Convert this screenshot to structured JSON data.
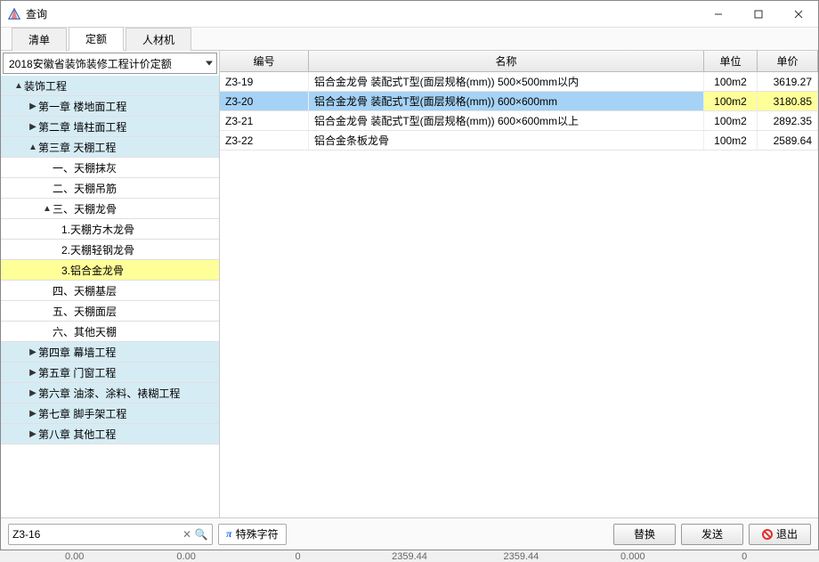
{
  "window": {
    "title": "查询"
  },
  "tabs": [
    {
      "label": "清单",
      "active": false
    },
    {
      "label": "定额",
      "active": true
    },
    {
      "label": "人材机",
      "active": false
    }
  ],
  "dropdown": {
    "value": "2018安徽省装饰装修工程计价定额"
  },
  "tree": [
    {
      "label": "装饰工程",
      "level": 0,
      "style": "blue",
      "caret": "▲"
    },
    {
      "label": "第一章 楼地面工程",
      "level": 1,
      "style": "blue",
      "caret": "▶"
    },
    {
      "label": "第二章 墙柱面工程",
      "level": 1,
      "style": "blue",
      "caret": "▶"
    },
    {
      "label": "第三章 天棚工程",
      "level": 1,
      "style": "blue",
      "caret": "▲"
    },
    {
      "label": "一、天棚抹灰",
      "level": 2,
      "style": "white",
      "caret": ""
    },
    {
      "label": "二、天棚吊筋",
      "level": 2,
      "style": "white",
      "caret": ""
    },
    {
      "label": "三、天棚龙骨",
      "level": 2,
      "style": "white",
      "caret": "▲"
    },
    {
      "label": "1.天棚方木龙骨",
      "level": 3,
      "style": "white",
      "caret": ""
    },
    {
      "label": "2.天棚轻钢龙骨",
      "level": 3,
      "style": "white",
      "caret": ""
    },
    {
      "label": "3.铝合金龙骨",
      "level": 3,
      "style": "yellow",
      "caret": ""
    },
    {
      "label": "四、天棚基层",
      "level": 2,
      "style": "white",
      "caret": ""
    },
    {
      "label": "五、天棚面层",
      "level": 2,
      "style": "white",
      "caret": ""
    },
    {
      "label": "六、其他天棚",
      "level": 2,
      "style": "white",
      "caret": ""
    },
    {
      "label": "第四章 幕墙工程",
      "level": 1,
      "style": "blue",
      "caret": "▶"
    },
    {
      "label": "第五章 门窗工程",
      "level": 1,
      "style": "blue",
      "caret": "▶"
    },
    {
      "label": "第六章 油漆、涂料、裱糊工程",
      "level": 1,
      "style": "blue",
      "caret": "▶"
    },
    {
      "label": "第七章 脚手架工程",
      "level": 1,
      "style": "blue",
      "caret": "▶"
    },
    {
      "label": "第八章 其他工程",
      "level": 1,
      "style": "blue",
      "caret": "▶"
    }
  ],
  "grid": {
    "headers": {
      "code": "编号",
      "name": "名称",
      "unit": "单位",
      "price": "单价"
    },
    "rows": [
      {
        "code": "Z3-19",
        "name": "铝合金龙骨 装配式T型(面层规格(mm)) 500×500mm以内",
        "unit": "100m2",
        "price": "3619.27",
        "selected": false
      },
      {
        "code": "Z3-20",
        "name": "铝合金龙骨 装配式T型(面层规格(mm)) 600×600mm",
        "unit": "100m2",
        "price": "3180.85",
        "selected": true
      },
      {
        "code": "Z3-21",
        "name": "铝合金龙骨 装配式T型(面层规格(mm)) 600×600mm以上",
        "unit": "100m2",
        "price": "2892.35",
        "selected": false
      },
      {
        "code": "Z3-22",
        "name": "铝合金条板龙骨",
        "unit": "100m2",
        "price": "2589.64",
        "selected": false
      }
    ]
  },
  "footer": {
    "search_value": "Z3-16",
    "special_chars": "特殊字符",
    "replace": "替换",
    "send": "发送",
    "exit": "退出"
  },
  "bg_numbers": [
    "0.00",
    "0.00",
    "0",
    "2359.44",
    "2359.44",
    "0.000",
    "0"
  ]
}
